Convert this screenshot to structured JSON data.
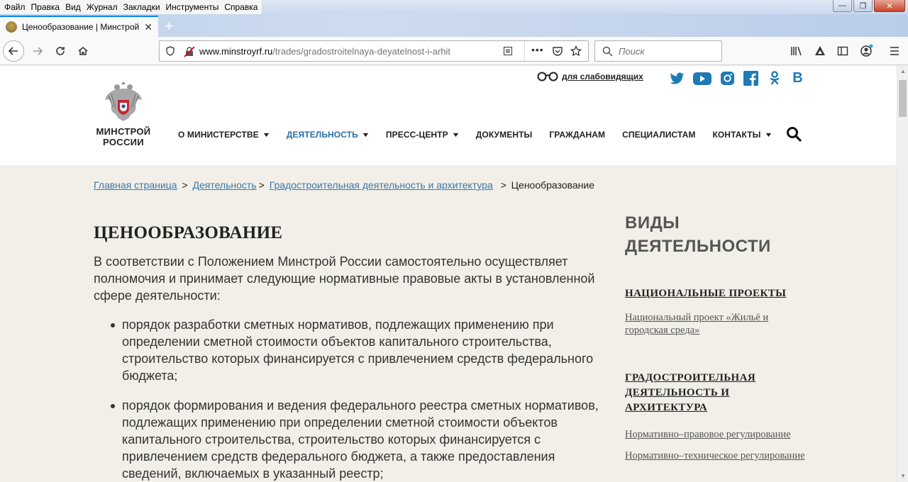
{
  "menubar": {
    "items": [
      "Файл",
      "Правка",
      "Вид",
      "Журнал",
      "Закладки",
      "Инструменты",
      "Справка"
    ]
  },
  "browser": {
    "tab_title": "Ценообразование | Минстрой России",
    "url_domain": "www.minstroyrf.ru",
    "url_path": "/trades/gradostroitelnaya-deyatelnost-i-arhit",
    "search_placeholder": "Поиск"
  },
  "site": {
    "logo_line1": "МИНСТРОЙ",
    "logo_line2": "РОССИИ",
    "low_vision": "для слабовидящих",
    "nav": [
      {
        "label": "О МИНИСТЕРСТВЕ",
        "dropdown": true,
        "active": false
      },
      {
        "label": "ДЕЯТЕЛЬНОСТЬ",
        "dropdown": true,
        "active": true
      },
      {
        "label": "ПРЕСС-ЦЕНТР",
        "dropdown": true,
        "active": false
      },
      {
        "label": "ДОКУМЕНТЫ",
        "dropdown": false,
        "active": false
      },
      {
        "label": "ГРАЖДАНАМ",
        "dropdown": false,
        "active": false
      },
      {
        "label": "СПЕЦИАЛИСТАМ",
        "dropdown": false,
        "active": false
      },
      {
        "label": "КОНТАКТЫ",
        "dropdown": true,
        "active": false
      }
    ],
    "accent_color": "#2b6fa6"
  },
  "breadcrumb": {
    "home": "Главная страница",
    "activity": "Деятельность",
    "section": "Градостроительная деятельность и архитектура",
    "current": "Ценообразование"
  },
  "content": {
    "title": "ЦЕНООБРАЗОВАНИЕ",
    "intro": "В соответствии с Положением Минстрой России самостоятельно осуществляет полномочия и принимает следующие нормативные правовые акты в установленной сфере деятельности:",
    "bullets": [
      "порядок разработки сметных нормативов, подлежащих применению при определении сметной стоимости объектов капитального строительства, строительство которых финансируется с привлечением средств федерального бюджета;",
      "порядок формирования и ведения федерального реестра сметных нормативов, подлежащих применению при определении сметной стоимости объектов капитального строительства, строительство которых финансируется с привлечением средств федерального бюджета, а также предоставления сведений, включаемых в указанный реестр;"
    ]
  },
  "aside": {
    "title_line1": "ВИДЫ",
    "title_line2": "ДЕЯТЕЛЬНОСТИ",
    "section1": "НАЦИОНАЛЬНЫЕ ПРОЕКТЫ",
    "section1_link": "Национальный проект «Жильё и городская среда»",
    "section2": "ГРАДОСТРОИТЕЛЬНАЯ ДЕЯТЕЛЬНОСТЬ И АРХИТЕКТУРА",
    "section2_links": [
      "Нормативно–правовое регулирование",
      "Нормативно–техническое регулирование"
    ]
  }
}
